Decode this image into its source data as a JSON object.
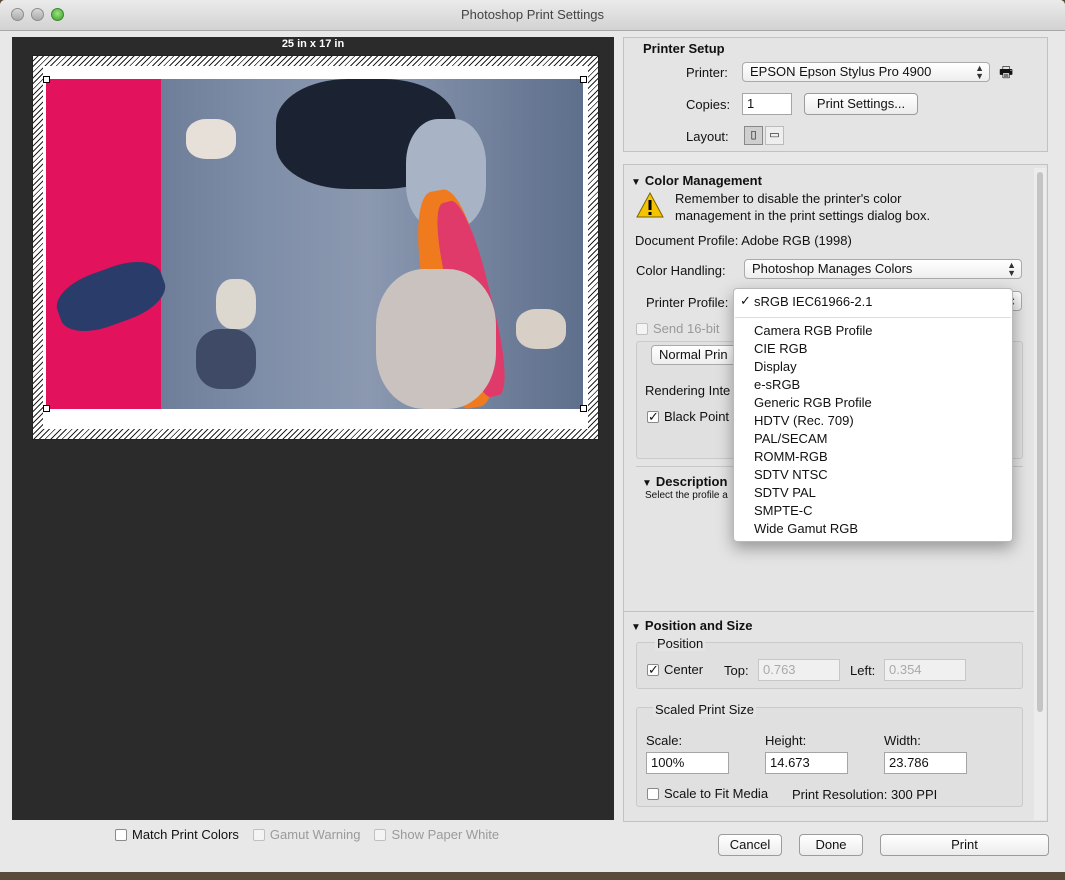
{
  "window": {
    "title": "Photoshop Print Settings"
  },
  "preview": {
    "paper_size_label": "25 in x 17 in",
    "match_print_colors": "Match Print Colors",
    "gamut_warning": "Gamut Warning",
    "show_paper_white": "Show Paper White"
  },
  "printer_setup": {
    "title": "Printer Setup",
    "printer_label": "Printer:",
    "printer_value": "EPSON Epson Stylus Pro 4900",
    "copies_label": "Copies:",
    "copies_value": "1",
    "print_settings_button": "Print Settings...",
    "layout_label": "Layout:"
  },
  "color_management": {
    "title": "Color Management",
    "warning_text_line1": "Remember to disable the printer's color",
    "warning_text_line2": "management in the print settings dialog box.",
    "document_profile": "Document Profile: Adobe RGB (1998)",
    "color_handling_label": "Color Handling:",
    "color_handling_value": "Photoshop Manages Colors",
    "printer_profile_label": "Printer Profile:",
    "send_16bit": "Send 16-bit",
    "normal_printing": "Normal Prin",
    "rendering_intent_label": "Rendering Inte",
    "black_point": "Black Point",
    "description_title": "Description",
    "description_text": "Select the profile a"
  },
  "printer_profile_menu": {
    "selected": "sRGB IEC61966-2.1",
    "items": [
      "Camera RGB Profile",
      "CIE RGB",
      "Display",
      "e-sRGB",
      "Generic RGB Profile",
      "HDTV (Rec. 709)",
      "PAL/SECAM",
      "ROMM-RGB",
      "SDTV NTSC",
      "SDTV PAL",
      "SMPTE-C",
      "Wide Gamut RGB"
    ]
  },
  "position_size": {
    "title": "Position and Size",
    "position_label": "Position",
    "center_label": "Center",
    "top_label": "Top:",
    "top_value": "0.763",
    "left_label": "Left:",
    "left_value": "0.354",
    "scaled_print_size_label": "Scaled Print Size",
    "scale_label": "Scale:",
    "scale_value": "100%",
    "height_label": "Height:",
    "height_value": "14.673",
    "width_label": "Width:",
    "width_value": "23.786",
    "scale_to_fit": "Scale to Fit Media",
    "print_resolution": "Print Resolution: 300 PPI"
  },
  "footer": {
    "cancel": "Cancel",
    "done": "Done",
    "print": "Print"
  }
}
